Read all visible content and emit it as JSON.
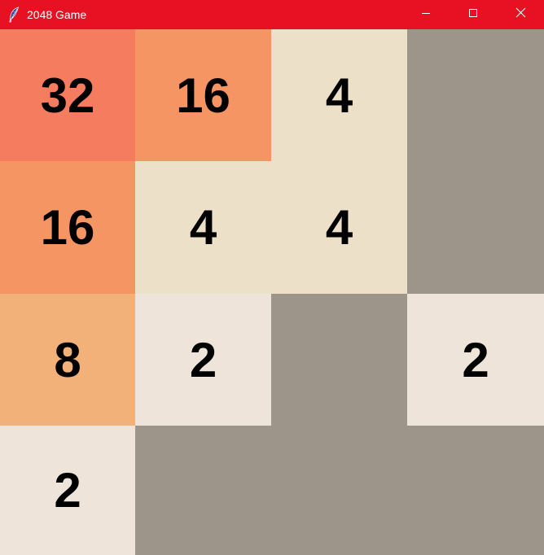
{
  "window": {
    "title": "2048 Game",
    "titlebar_color": "#e81123",
    "icon": "feather-icon",
    "controls": {
      "minimize": "minimize-icon",
      "maximize": "maximize-icon",
      "close": "close-icon"
    }
  },
  "board": {
    "empty_color": "#9e958a",
    "rows": [
      [
        {
          "value": "32",
          "color": "#f67c5f"
        },
        {
          "value": "16",
          "color": "#f59563"
        },
        {
          "value": "4",
          "color": "#ede0c8"
        },
        {
          "value": "",
          "color": "#9e958a"
        }
      ],
      [
        {
          "value": "16",
          "color": "#f59563"
        },
        {
          "value": "4",
          "color": "#ede0c8"
        },
        {
          "value": "4",
          "color": "#ede0c8"
        },
        {
          "value": "",
          "color": "#9e958a"
        }
      ],
      [
        {
          "value": "8",
          "color": "#f2b179"
        },
        {
          "value": "2",
          "color": "#eee4da"
        },
        {
          "value": "",
          "color": "#9e958a"
        },
        {
          "value": "2",
          "color": "#eee4da"
        }
      ],
      [
        {
          "value": "2",
          "color": "#eee4da"
        },
        {
          "value": "",
          "color": "#9e958a"
        },
        {
          "value": "",
          "color": "#9e958a"
        },
        {
          "value": "",
          "color": "#9e958a"
        }
      ]
    ]
  }
}
